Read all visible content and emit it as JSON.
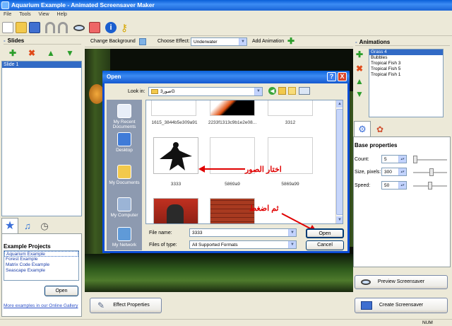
{
  "window": {
    "title": "Aquarium Example - Animated Screensaver Maker"
  },
  "menu": [
    "File",
    "Tools",
    "View",
    "Help"
  ],
  "options_bar": {
    "change_background": "Change Background",
    "choose_effect_label": "Choose Effect:",
    "effect_value": "Underwater",
    "add_animation": "Add Animation"
  },
  "slides": {
    "title": "Slides",
    "items": [
      "Slide 1"
    ]
  },
  "example_projects": {
    "title": "Example Projects",
    "items": [
      "Aquarium Example",
      "Forest Example",
      "Matrix Code Example",
      "Seascape Example"
    ],
    "open_button": "Open",
    "gallery_link": "More examples in our Online Gallery"
  },
  "animations": {
    "title": "Animations",
    "items": [
      "Grass 4",
      "Bubbles",
      "Tropical Fish 3",
      "Tropical Fish 5",
      "Tropical Fish 1"
    ]
  },
  "base_properties": {
    "title": "Base properties",
    "count_label": "Count:",
    "count_value": "5",
    "size_label": "Size, pixels:",
    "size_value": "300",
    "speed_label": "Speed:",
    "speed_value": "50"
  },
  "buttons": {
    "effect_properties": "Effect Properties",
    "preview": "Preview Screensaver",
    "create": "Create Screensaver"
  },
  "open_dialog": {
    "title": "Open",
    "help": "?",
    "close": "X",
    "look_in_label": "Look in:",
    "look_in_value": "صور3G",
    "places": [
      "My Recent Documents",
      "Desktop",
      "My Documents",
      "My Computer",
      "My Network"
    ],
    "files": [
      "1615_3844b5e309a91",
      "2233f1313c9b1e2e08...",
      "3312",
      "3333",
      "5869a9",
      "5869a99"
    ],
    "file_name_label": "File name:",
    "file_name_value": "3333",
    "files_of_type_label": "Files of type:",
    "files_of_type_value": "All Supported Formats",
    "open_button": "Open",
    "cancel_button": "Cancel"
  },
  "annotations": {
    "choose_images": "اختار الصور",
    "then_press": "ثم اضغط"
  },
  "status": {
    "num": "NUM"
  },
  "colors": {
    "title_bar": "#0a5fd8",
    "selection": "#316ac5",
    "annotation": "#e00000"
  }
}
